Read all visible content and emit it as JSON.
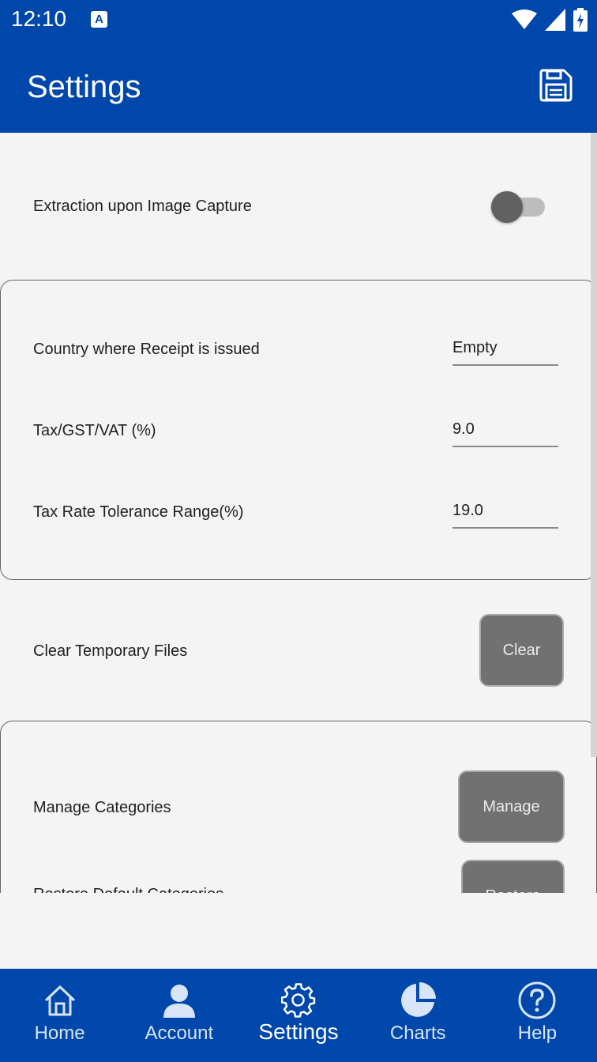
{
  "status_bar": {
    "time": "12:10",
    "notification_letter": "A"
  },
  "app_bar": {
    "title": "Settings",
    "save_icon": "save-icon"
  },
  "settings": {
    "extraction_label": "Extraction upon Image Capture",
    "extraction_enabled": false,
    "country_label": "Country where Receipt is issued",
    "country_value": "Empty",
    "tax_label": "Tax/GST/VAT (%)",
    "tax_value": "9.0",
    "tolerance_label": "Tax Rate Tolerance Range(%)",
    "tolerance_value": "19.0",
    "clear_label": "Clear Temporary Files",
    "clear_button": "Clear",
    "manage_label": "Manage Categories",
    "manage_button": "Manage",
    "restore_label": "Restore Default Categories",
    "restore_button": "Restore"
  },
  "nav": {
    "items": [
      {
        "label": "Home",
        "icon": "home-icon",
        "active": false
      },
      {
        "label": "Account",
        "icon": "account-icon",
        "active": false
      },
      {
        "label": "Settings",
        "icon": "settings-gear-icon",
        "active": true
      },
      {
        "label": "Charts",
        "icon": "pie-chart-icon",
        "active": false
      },
      {
        "label": "Help",
        "icon": "help-icon",
        "active": false
      }
    ]
  },
  "colors": {
    "primary": "#0047ab",
    "background": "#f4f4f4",
    "button": "#717171"
  }
}
